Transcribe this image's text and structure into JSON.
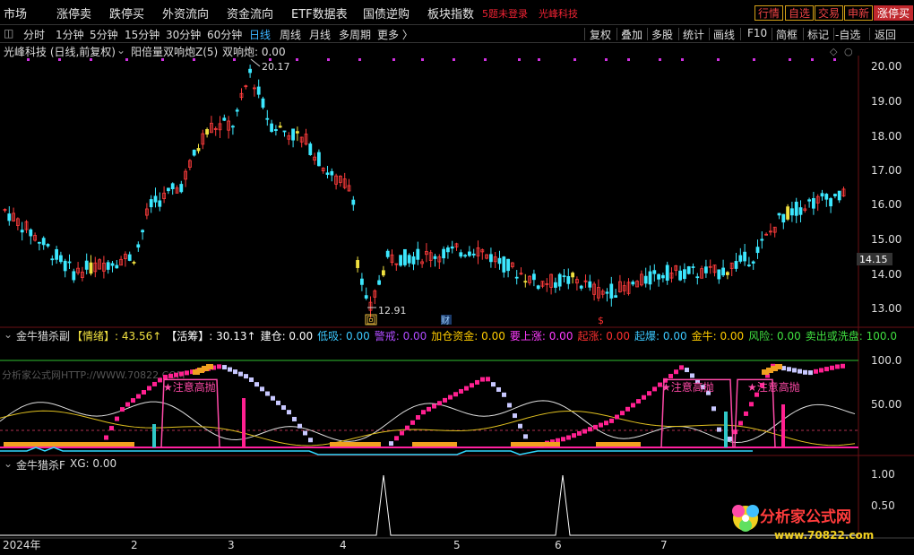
{
  "nav": {
    "items": [
      "市场",
      "涨停卖",
      "跌停买",
      "外资流向",
      "资金流向",
      "ETF数据表",
      "国债逆购",
      "板块指数"
    ],
    "red_labels": [
      "5题未登录",
      "光峰科技"
    ],
    "right_buttons": [
      "行情",
      "自选",
      "交易",
      "申新",
      "涨停买"
    ]
  },
  "period_bar": {
    "periods": [
      "分时",
      "1分钟",
      "5分钟",
      "15分钟",
      "30分钟",
      "60分钟",
      "日线",
      "周线",
      "月线",
      "多周期",
      "更多 〉"
    ],
    "active": "日线",
    "tools": [
      "复权",
      "叠加",
      "多股",
      "统计",
      "画线",
      "F10",
      "简框",
      "标记",
      "-自选",
      "返回"
    ]
  },
  "main_panel": {
    "stock_title": "光峰科技 (日线,前复权)",
    "indicator_name": "阳倍量双响炮Z(5)",
    "indicator_value": "双响炮: 0.00",
    "high_label": "20.17",
    "low_label": "12.91",
    "current_price_tag": "14.15",
    "y_ticks": [
      "20.00",
      "19.00",
      "18.00",
      "17.00",
      "16.00",
      "15.00",
      "14.00",
      "13.00"
    ],
    "event_markers": [
      "回",
      "财",
      "$"
    ]
  },
  "sub_panel_1": {
    "name": "金牛猎杀副",
    "legend": [
      {
        "label": "【情绪】: 43.56↑",
        "color": "#f0e040"
      },
      {
        "label": "【活筹】: 30.13↑",
        "color": "#ffffff"
      },
      {
        "label": "建仓: 0.00",
        "color": "#ffffff"
      },
      {
        "label": "低吸: 0.00",
        "color": "#3cc8ff"
      },
      {
        "label": "警戒: 0.00",
        "color": "#b04cff"
      },
      {
        "label": "加仓资金: 0.00",
        "color": "#ffcc00"
      },
      {
        "label": "要上涨: 0.00",
        "color": "#ff3cff"
      },
      {
        "label": "起涨: 0.00",
        "color": "#ff3030"
      },
      {
        "label": "起爆: 0.00",
        "color": "#3cc8ff"
      },
      {
        "label": "金牛: 0.00",
        "color": "#ffcc00"
      },
      {
        "label": "风险: 0.00",
        "color": "#40e040"
      },
      {
        "label": "卖出或洗盘: 100.0",
        "color": "#40e040"
      }
    ],
    "y_ticks": [
      "100.0",
      "50.00"
    ],
    "annotations": [
      "★注意高抛",
      "★注意高抛",
      "★注意高抛"
    ],
    "watermark": "分析家公式网HTTP://WWW.70822.COM"
  },
  "sub_panel_2": {
    "name": "金牛猎杀F",
    "value": "XG: 0.00",
    "y_ticks": [
      "1.00",
      "0.50"
    ]
  },
  "time_axis": [
    "2024年",
    "2",
    "3",
    "4",
    "5",
    "6",
    "7"
  ],
  "logo": {
    "text": "分析家公式网",
    "url": "www.70822.com"
  },
  "colors": {
    "up": "#ff3c3c",
    "down": "#3ce8ff",
    "yellow": "#f0e040",
    "magenta": "#ff2090",
    "lavender": "#c8c8ff",
    "grid_red": "#6a0f14"
  }
}
